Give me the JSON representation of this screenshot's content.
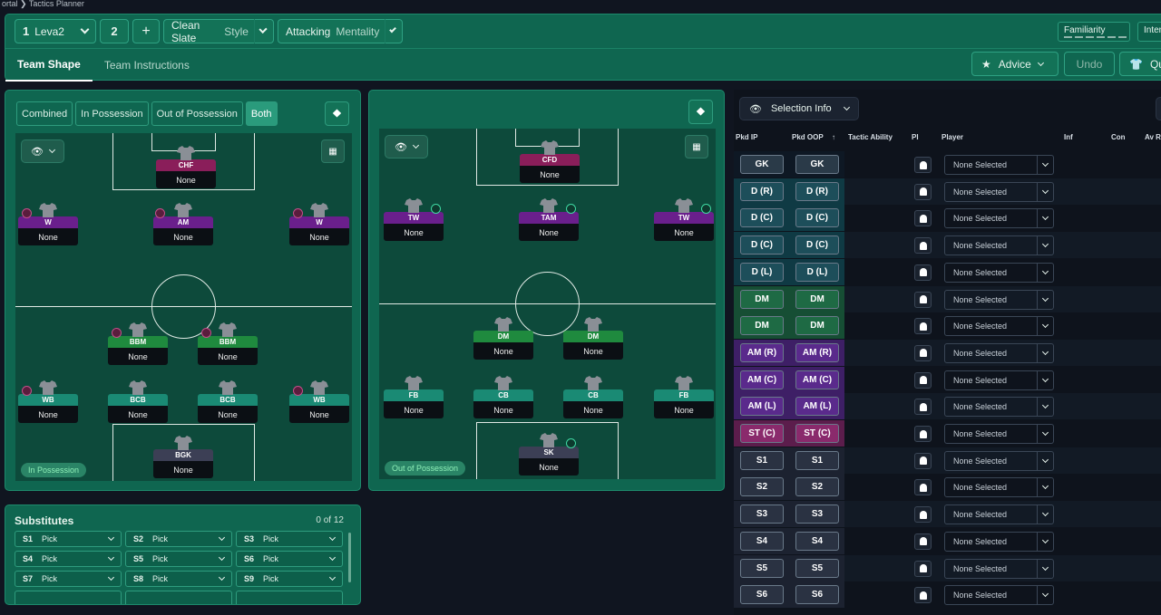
{
  "breadcrumb": "ortal  ❯  Tactics Planner",
  "toolbar": {
    "tactic_num": "1",
    "tactic_name": "Leva2",
    "slot2": "2",
    "add": "+",
    "style_value": "Clean Slate",
    "style_label": "Style",
    "mentality_value": "Attacking",
    "mentality_label": "Mentality",
    "familiarity": "Familiarity",
    "intensity": "Inten",
    "advice": "Advice",
    "undo": "Undo",
    "quick": "Quic"
  },
  "tabs": [
    "Team Shape",
    "Team Instructions"
  ],
  "view_toggle": [
    "Combined",
    "In Possession",
    "Out of Possession",
    "Both"
  ],
  "pitch_ip": {
    "label": "In Possession",
    "players": [
      {
        "role": "CHF",
        "name": "None",
        "color": "#8a1e5a"
      },
      {
        "role": "W",
        "name": "None",
        "color": "#6a1f8c"
      },
      {
        "role": "AM",
        "name": "None",
        "color": "#6a1f8c"
      },
      {
        "role": "W",
        "name": "None",
        "color": "#6a1f8c"
      },
      {
        "role": "BBM",
        "name": "None",
        "color": "#1f8a3e"
      },
      {
        "role": "BBM",
        "name": "None",
        "color": "#1f8a3e"
      },
      {
        "role": "WB",
        "name": "None",
        "color": "#1a8a74"
      },
      {
        "role": "BCB",
        "name": "None",
        "color": "#1a8a74"
      },
      {
        "role": "BCB",
        "name": "None",
        "color": "#1a8a74"
      },
      {
        "role": "WB",
        "name": "None",
        "color": "#1a8a74"
      },
      {
        "role": "BGK",
        "name": "None",
        "color": "#3c3f55"
      }
    ]
  },
  "pitch_oop": {
    "label": "Out of Possession",
    "players": [
      {
        "role": "CFD",
        "name": "None",
        "color": "#8a1e5a"
      },
      {
        "role": "TW",
        "name": "None",
        "color": "#6a1f8c"
      },
      {
        "role": "TAM",
        "name": "None",
        "color": "#6a1f8c"
      },
      {
        "role": "TW",
        "name": "None",
        "color": "#6a1f8c"
      },
      {
        "role": "DM",
        "name": "None",
        "color": "#1f8a3e"
      },
      {
        "role": "DM",
        "name": "None",
        "color": "#1f8a3e"
      },
      {
        "role": "FB",
        "name": "None",
        "color": "#1a8a74"
      },
      {
        "role": "CB",
        "name": "None",
        "color": "#1a8a74"
      },
      {
        "role": "CB",
        "name": "None",
        "color": "#1a8a74"
      },
      {
        "role": "FB",
        "name": "None",
        "color": "#1a8a74"
      },
      {
        "role": "SK",
        "name": "None",
        "color": "#3c3f55"
      }
    ]
  },
  "substitutes": {
    "title": "Substitutes",
    "count": "0 of 12",
    "slots": [
      {
        "id": "S1",
        "label": "Pick"
      },
      {
        "id": "S2",
        "label": "Pick"
      },
      {
        "id": "S3",
        "label": "Pick"
      },
      {
        "id": "S4",
        "label": "Pick"
      },
      {
        "id": "S5",
        "label": "Pick"
      },
      {
        "id": "S6",
        "label": "Pick"
      },
      {
        "id": "S7",
        "label": "Pick"
      },
      {
        "id": "S8",
        "label": "Pick"
      },
      {
        "id": "S9",
        "label": "Pick"
      }
    ]
  },
  "selection": {
    "button": "Selection Info",
    "filter": "F",
    "headers": {
      "pkd_ip": "Pkd IP",
      "pkd_oop": "Pkd OOP",
      "tactic_ability": "Tactic Ability",
      "pi": "PI",
      "player": "Player",
      "inf": "Inf",
      "con": "Con",
      "av": "Av R"
    },
    "rows": [
      {
        "ip": "GK",
        "oop": "GK",
        "player": "None Selected",
        "group": "gk"
      },
      {
        "ip": "D (R)",
        "oop": "D (R)",
        "player": "None Selected",
        "group": "def"
      },
      {
        "ip": "D (C)",
        "oop": "D (C)",
        "player": "None Selected",
        "group": "def"
      },
      {
        "ip": "D (C)",
        "oop": "D (C)",
        "player": "None Selected",
        "group": "def"
      },
      {
        "ip": "D (L)",
        "oop": "D (L)",
        "player": "None Selected",
        "group": "def"
      },
      {
        "ip": "DM",
        "oop": "DM",
        "player": "None Selected",
        "group": "dm"
      },
      {
        "ip": "DM",
        "oop": "DM",
        "player": "None Selected",
        "group": "dm"
      },
      {
        "ip": "AM (R)",
        "oop": "AM (R)",
        "player": "None Selected",
        "group": "am"
      },
      {
        "ip": "AM (C)",
        "oop": "AM (C)",
        "player": "None Selected",
        "group": "am"
      },
      {
        "ip": "AM (L)",
        "oop": "AM (L)",
        "player": "None Selected",
        "group": "am"
      },
      {
        "ip": "ST (C)",
        "oop": "ST (C)",
        "player": "None Selected",
        "group": "st"
      },
      {
        "ip": "S1",
        "oop": "S1",
        "player": "None Selected",
        "group": "sub"
      },
      {
        "ip": "S2",
        "oop": "S2",
        "player": "None Selected",
        "group": "sub"
      },
      {
        "ip": "S3",
        "oop": "S3",
        "player": "None Selected",
        "group": "sub"
      },
      {
        "ip": "S4",
        "oop": "S4",
        "player": "None Selected",
        "group": "sub"
      },
      {
        "ip": "S5",
        "oop": "S5",
        "player": "None Selected",
        "group": "sub"
      },
      {
        "ip": "S6",
        "oop": "S6",
        "player": "None Selected",
        "group": "sub"
      }
    ]
  }
}
